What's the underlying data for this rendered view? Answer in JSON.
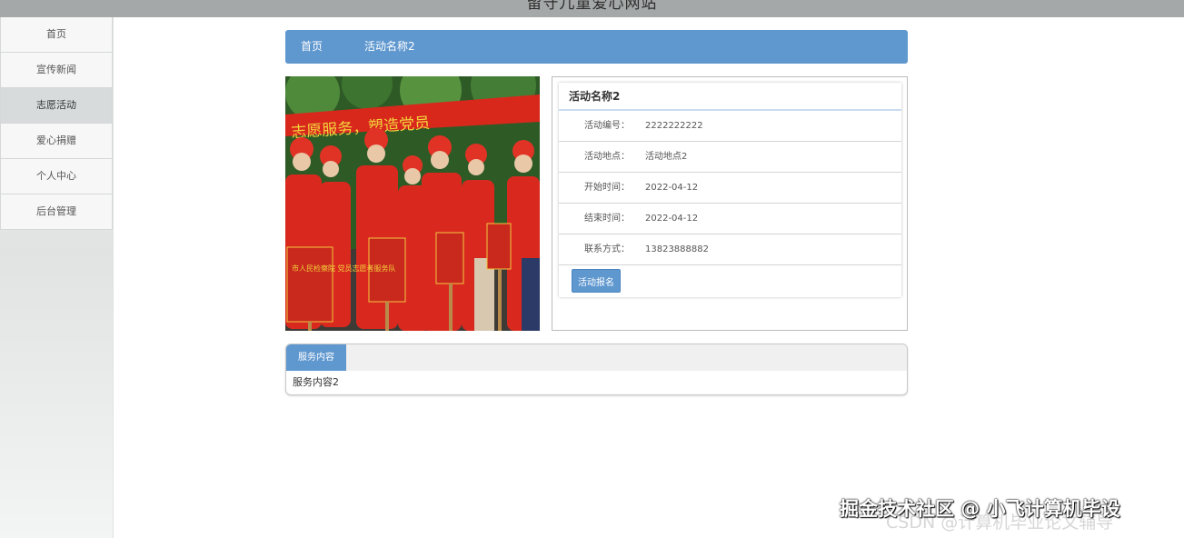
{
  "site": {
    "title": "留守儿童爱心网站"
  },
  "nav": {
    "items": [
      {
        "label": "首页"
      },
      {
        "label": "宣传新闻"
      },
      {
        "label": "志愿活动"
      },
      {
        "label": "爱心捐赠"
      },
      {
        "label": "个人中心"
      },
      {
        "label": "后台管理"
      }
    ],
    "active_label": "志愿活动"
  },
  "breadcrumb": {
    "home": "首页",
    "current": "活动名称2"
  },
  "activity": {
    "name": "活动名称2",
    "fields": [
      {
        "label": "活动编号：",
        "value": "2222222222"
      },
      {
        "label": "活动地点：",
        "value": "活动地点2"
      },
      {
        "label": "开始时间：",
        "value": "2022-04-12"
      },
      {
        "label": "结束时间：",
        "value": "2022-04-12"
      },
      {
        "label": "联系方式：",
        "value": "13823888882"
      }
    ],
    "signup_button": "活动报名",
    "photo": {
      "banner_text": "志愿服务，塑造党员",
      "sign_text": "市人民检察院 党员志愿者服务队"
    }
  },
  "service": {
    "tab_label": "服务内容",
    "content": "服务内容2"
  },
  "watermark": {
    "front": "掘金技术社区 @ 小飞计算机毕设",
    "back": "CSDN @计算机毕业论文辅导"
  },
  "colors": {
    "accent": "#5f97cf",
    "topbar": "#a5a8a8",
    "nav_active": "#d7dbdb"
  }
}
